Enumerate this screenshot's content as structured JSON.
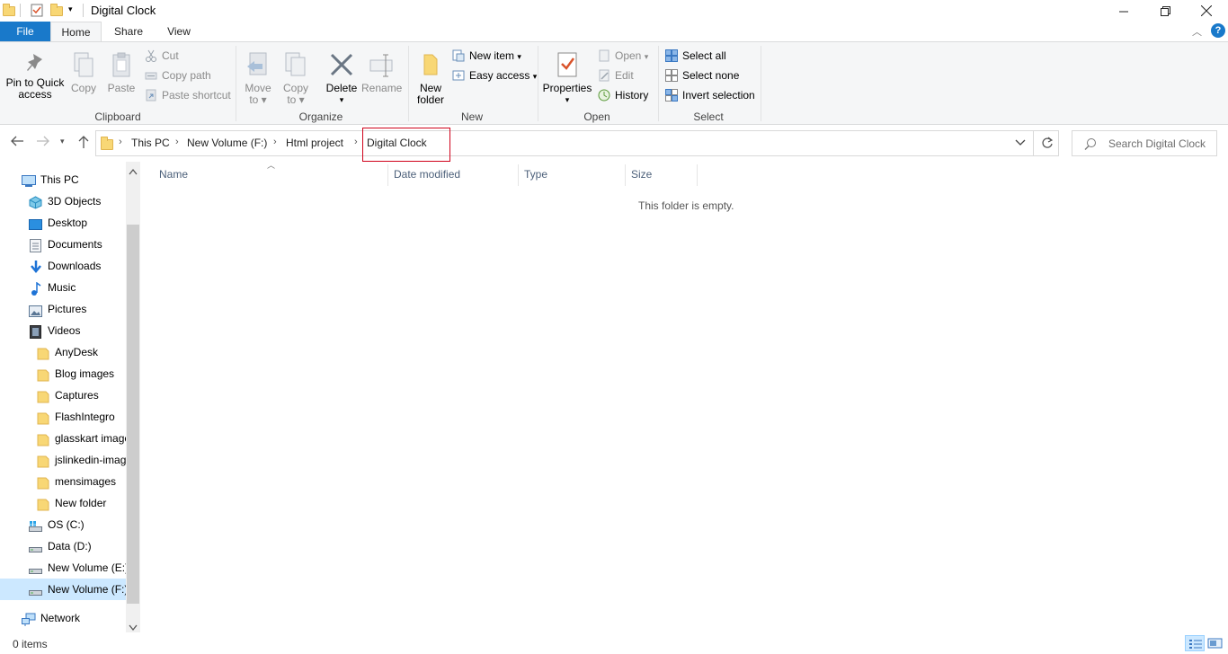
{
  "window": {
    "title": "Digital Clock"
  },
  "ribbon_tabs": {
    "file": "File",
    "home": "Home",
    "share": "Share",
    "view": "View"
  },
  "ribbon": {
    "clipboard": {
      "label": "Clipboard",
      "pin_l1": "Pin to Quick",
      "pin_l2": "access",
      "copy": "Copy",
      "paste": "Paste",
      "cut": "Cut",
      "copy_path": "Copy path",
      "paste_shortcut": "Paste shortcut"
    },
    "organize": {
      "label": "Organize",
      "move_l1": "Move",
      "move_l2": "to",
      "copy_l1": "Copy",
      "copy_l2": "to",
      "delete": "Delete",
      "rename": "Rename"
    },
    "new": {
      "label": "New",
      "new_folder_l1": "New",
      "new_folder_l2": "folder",
      "new_item": "New item",
      "easy_access": "Easy access"
    },
    "open": {
      "label": "Open",
      "properties": "Properties",
      "open": "Open",
      "edit": "Edit",
      "history": "History"
    },
    "select": {
      "label": "Select",
      "select_all": "Select all",
      "select_none": "Select none",
      "invert": "Invert selection"
    }
  },
  "address": {
    "crumbs": [
      "This PC",
      "New Volume (F:)",
      "Html project",
      "Digital Clock"
    ],
    "search_placeholder": "Search Digital Clock"
  },
  "nav": {
    "this_pc": "This PC",
    "items": [
      {
        "label": "3D Objects",
        "icon": "3d-objects-icon"
      },
      {
        "label": "Desktop",
        "icon": "desktop-icon"
      },
      {
        "label": "Documents",
        "icon": "documents-icon"
      },
      {
        "label": "Downloads",
        "icon": "downloads-icon"
      },
      {
        "label": "Music",
        "icon": "music-icon"
      },
      {
        "label": "Pictures",
        "icon": "pictures-icon"
      },
      {
        "label": "Videos",
        "icon": "videos-icon"
      }
    ],
    "folders": [
      "AnyDesk",
      "Blog images",
      "Captures",
      "FlashIntegro",
      "glasskart images",
      "jslinkedin-images",
      "mensimages",
      "New folder"
    ],
    "drives": [
      "OS (C:)",
      "Data (D:)",
      "New Volume (E:)",
      "New Volume (F:)"
    ],
    "network": "Network"
  },
  "columns": {
    "name": "Name",
    "date_modified": "Date modified",
    "type": "Type",
    "size": "Size"
  },
  "content": {
    "empty_message": "This folder is empty."
  },
  "status": {
    "items": "0 items"
  },
  "colors": {
    "accent": "#1979ca",
    "selected": "#cce8ff",
    "highlight_border": "#d0021b",
    "folder": "#f8d775"
  }
}
